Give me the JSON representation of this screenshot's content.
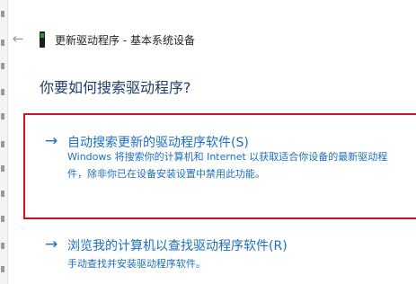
{
  "window": {
    "title": "更新驱动程序 - 基本系统设备"
  },
  "icons": {
    "back": "back-arrow-icon",
    "device": "device-icon",
    "option_arrow": "right-arrow-icon"
  },
  "heading": "你要如何搜索驱动程序?",
  "options": [
    {
      "title": "自动搜索更新的驱动程序软件(S)",
      "desc_line1": "Windows 将搜索你的计算机和 Internet 以获取适合你设备的最新驱动程",
      "desc_line2": "件，除非你已在设备安装设置中禁用此功能。"
    },
    {
      "title": "浏览我的计算机以查找驱动程序软件(R)",
      "desc": "手动查找并安装驱动程序软件。"
    }
  ],
  "colors": {
    "link_blue": "#1c6fbf",
    "highlight_red": "#c8161d",
    "heading_blue": "#1d3c6e"
  }
}
